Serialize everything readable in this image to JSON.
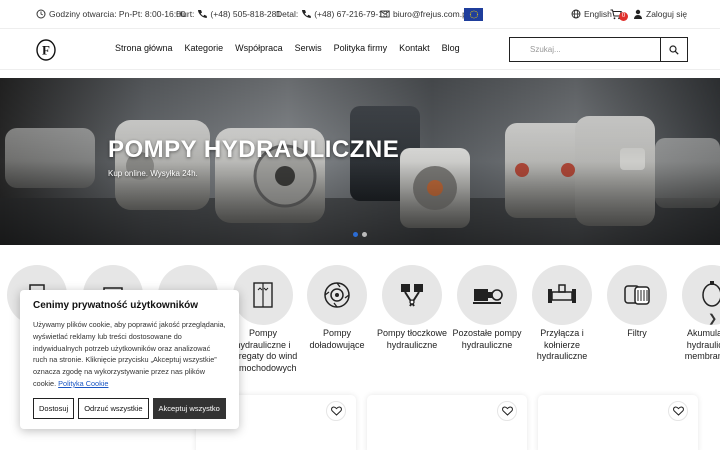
{
  "topbar": {
    "hours": "Godziny otwarcia: Pn-Pt: 8:00-16:00",
    "wholesale_label": "Hurt:",
    "wholesale_phone": "(+48) 505-818-281",
    "retail_label": "Detal:",
    "retail_phone": "(+48) 67-216-79-13",
    "email": "biuro@frejus.com.pl",
    "language": "English",
    "cart_count": "0",
    "login": "Zaloguj się"
  },
  "header": {
    "logo_letter": "F",
    "nav": [
      "Strona główna",
      "Kategorie",
      "Współpraca",
      "Serwis",
      "Polityka firmy",
      "Kontakt",
      "Blog"
    ],
    "search_placeholder": "Szukaj..."
  },
  "hero": {
    "title": "POMPY HYDRAULICZNE",
    "subtitle": "Kup online. Wysyłka 24h.",
    "active_slide": 1,
    "slide_count": 2
  },
  "categories": [
    {
      "label": "",
      "icon": "document-icon"
    },
    {
      "label": "",
      "icon": "box-icon"
    },
    {
      "label": "",
      "icon": "block-icon"
    },
    {
      "label": "Pompy hydrauliczne i agregaty do wind samochodowych",
      "icon": "elevator-icon"
    },
    {
      "label": "Pompy doładowujące",
      "icon": "turbine-pump-icon"
    },
    {
      "label": "Pompy tłoczkowe hydrauliczne",
      "icon": "piston-icon"
    },
    {
      "label": "Pozostałe pompy hydrauliczne",
      "icon": "motor-pump-icon"
    },
    {
      "label": "Przyłącza i kołnierze hydrauliczne",
      "icon": "flange-icon"
    },
    {
      "label": "Filtry",
      "icon": "filter-icon"
    },
    {
      "label": "Akumulatory hydrauliczne membranowe",
      "icon": "accumulator-icon"
    }
  ],
  "cookie": {
    "title": "Cenimy prywatność użytkowników",
    "text": "Używamy plików cookie, aby poprawić jakość przeglądania, wyświetlać reklamy lub treści dostosowane do indywidualnych potrzeb użytkowników oraz analizować ruch na stronie. Kliknięcie przycisku „Akceptuj wszystkie” oznacza zgodę na wykorzystywanie przez nas plików cookie.",
    "policy_link": "Polityka Cookie",
    "btn_customize": "Dostosuj",
    "btn_reject": "Odrzuć wszystkie",
    "btn_accept": "Akceptuj wszystko"
  },
  "colors": {
    "accent_dot": "#2b6cd4",
    "badge": "#e0302c",
    "eu_flag": "#1f3e9c"
  }
}
